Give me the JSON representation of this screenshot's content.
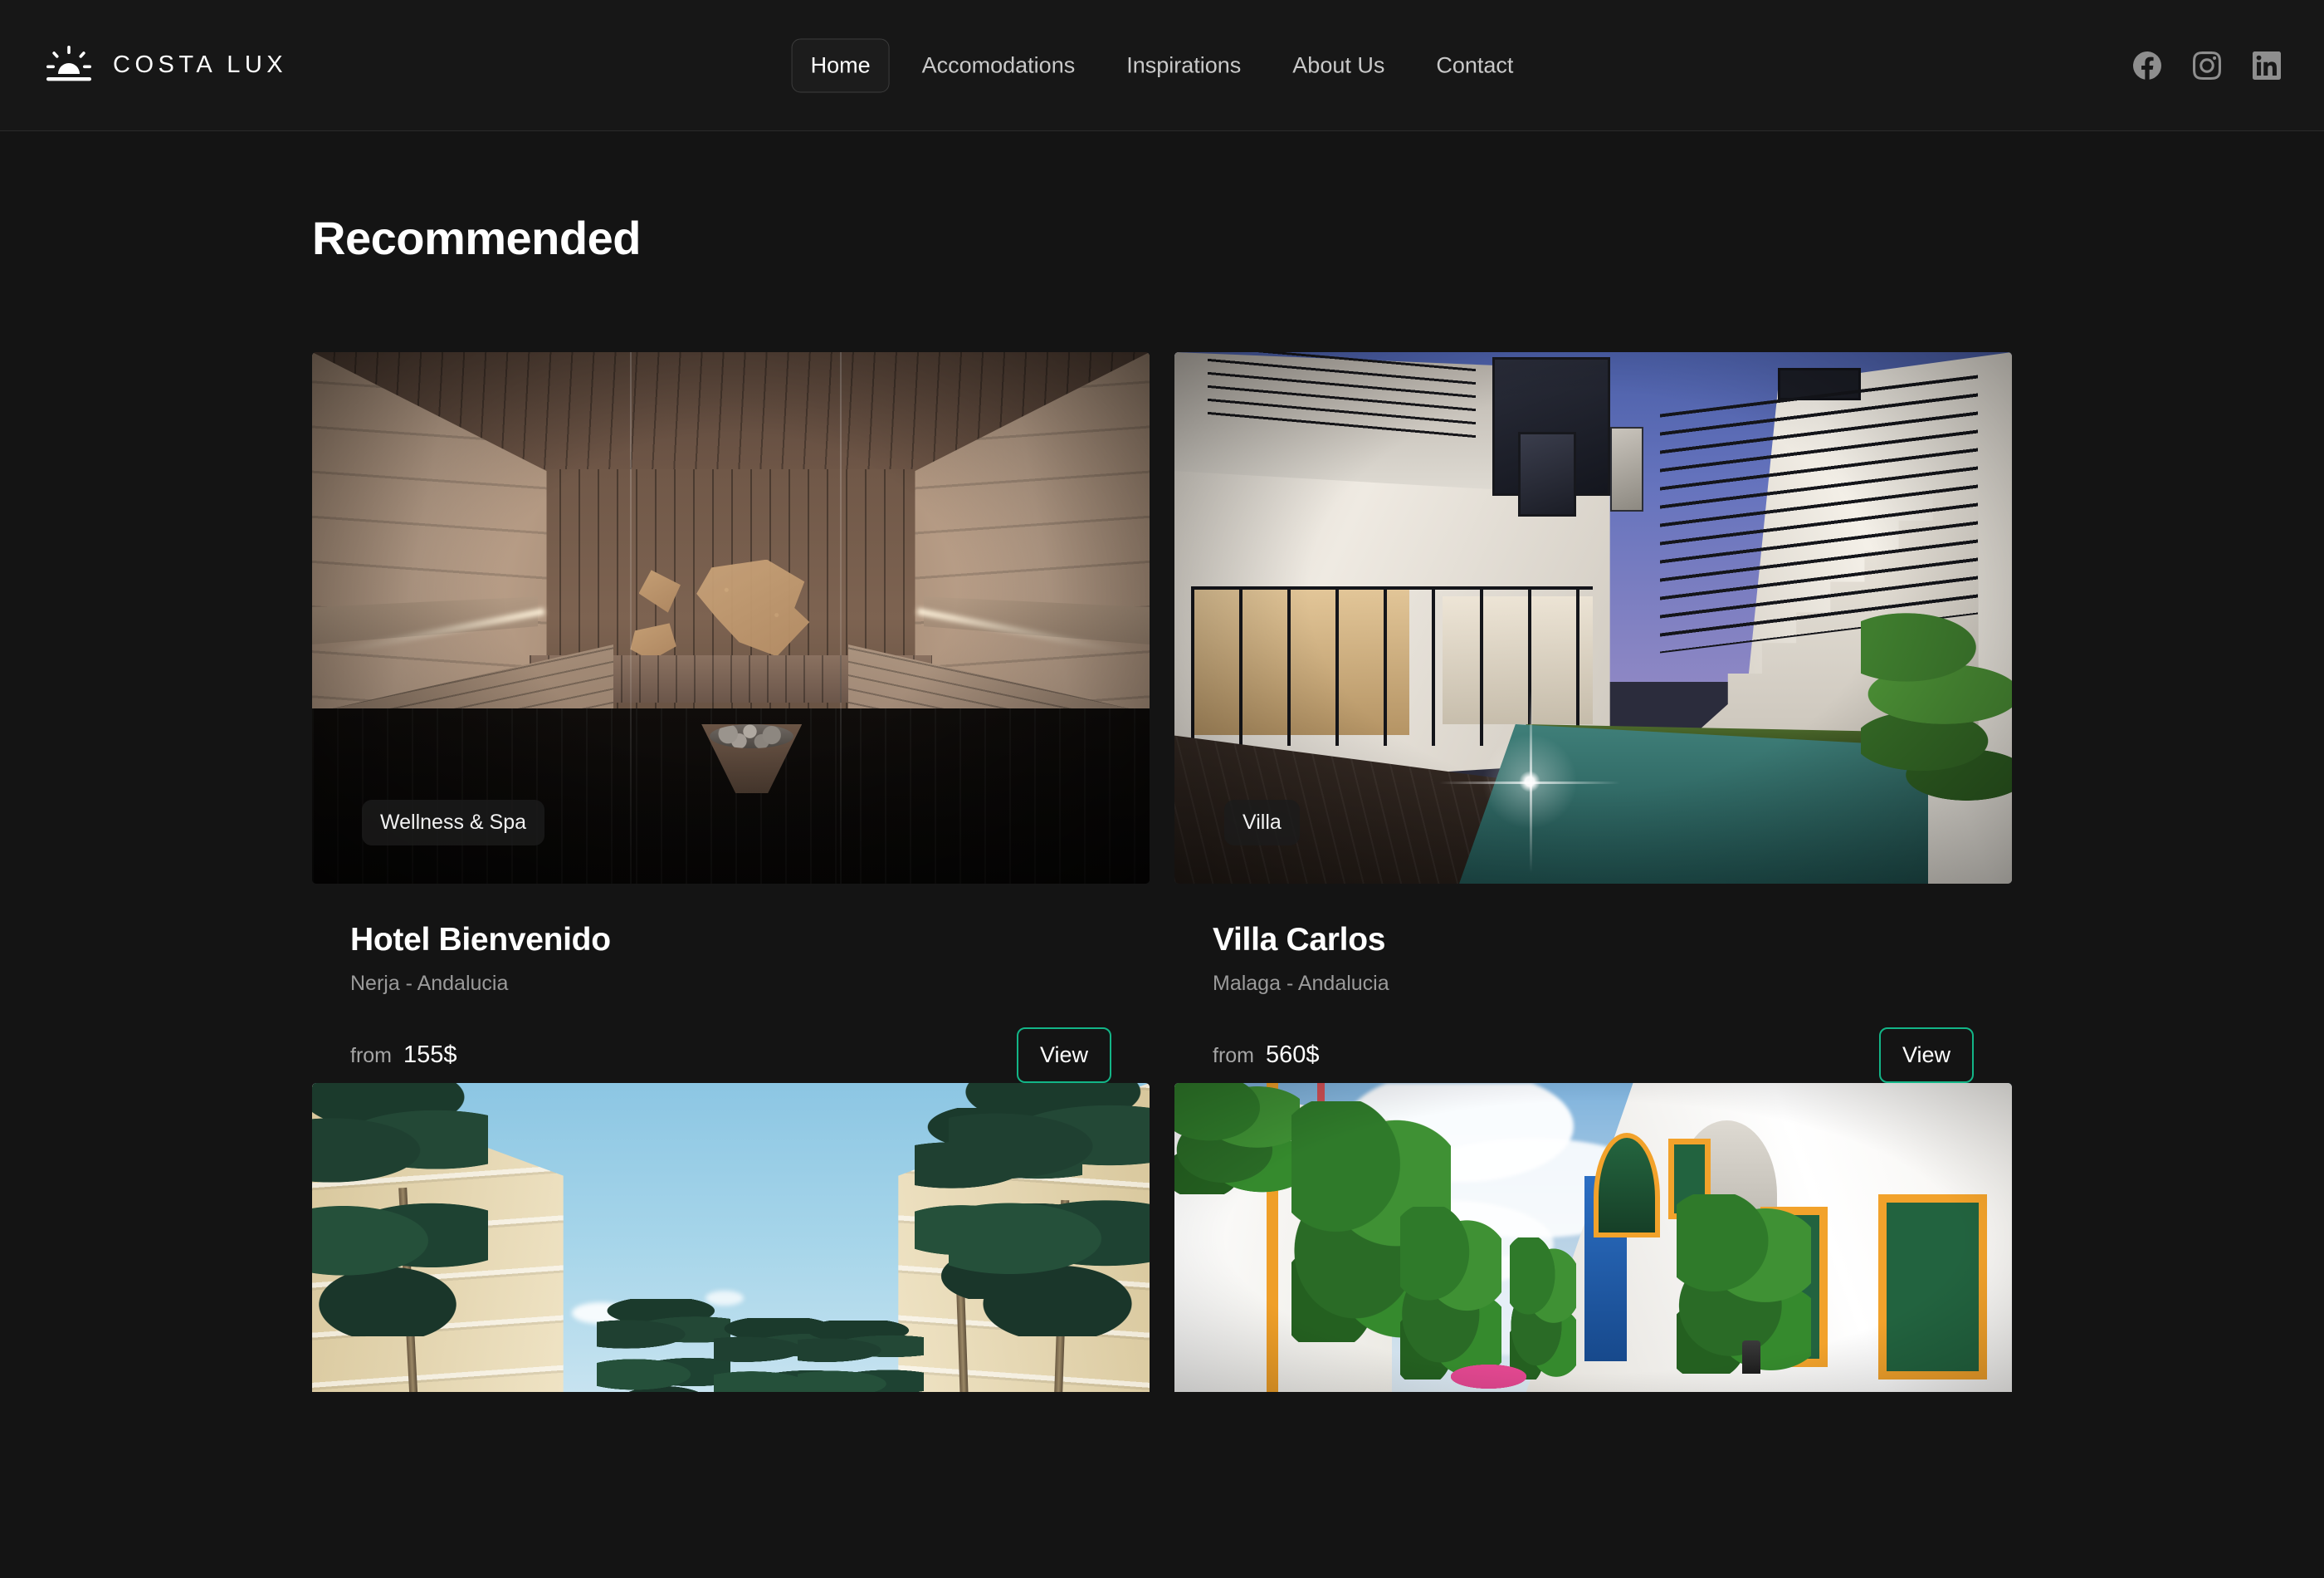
{
  "header": {
    "brand": {
      "name": "COSTA LUX",
      "logo_icon": "sunrise-icon"
    },
    "nav": [
      {
        "label": "Home",
        "active": true
      },
      {
        "label": "Accomodations",
        "active": false
      },
      {
        "label": "Inspirations",
        "active": false
      },
      {
        "label": "About Us",
        "active": false
      },
      {
        "label": "Contact",
        "active": false
      }
    ],
    "socials": [
      {
        "name": "facebook-icon"
      },
      {
        "name": "instagram-icon"
      },
      {
        "name": "linkedin-icon"
      }
    ]
  },
  "main": {
    "section_title": "Recommended",
    "cards": [
      {
        "badge": "Wellness & Spa",
        "title": "Hotel Bienvenido",
        "location": "Nerja - Andalucia",
        "price_from_label": "from",
        "price_value": "155$",
        "view_label": "View",
        "image_alt": "sauna-interior"
      },
      {
        "badge": "Villa",
        "title": "Villa Carlos",
        "location": "Malaga - Andalucia",
        "price_from_label": "from",
        "price_value": "560$",
        "view_label": "View",
        "image_alt": "villa-with-pool-at-dusk"
      },
      {
        "badge": "",
        "title": "",
        "location": "",
        "price_from_label": "",
        "price_value": "",
        "view_label": "",
        "image_alt": "palm-trees-and-apartment-buildings"
      },
      {
        "badge": "",
        "title": "",
        "location": "",
        "price_from_label": "",
        "price_value": "",
        "view_label": "",
        "image_alt": "colorful-spanish-street"
      }
    ]
  },
  "colors": {
    "page_background": "#141414",
    "header_background": "#171717",
    "accent": "#13b587",
    "text_primary": "#ffffff",
    "text_muted": "#9a9a9a",
    "social_icon": "#8e8e8e",
    "nav_active_border": "#3c3c3c"
  }
}
